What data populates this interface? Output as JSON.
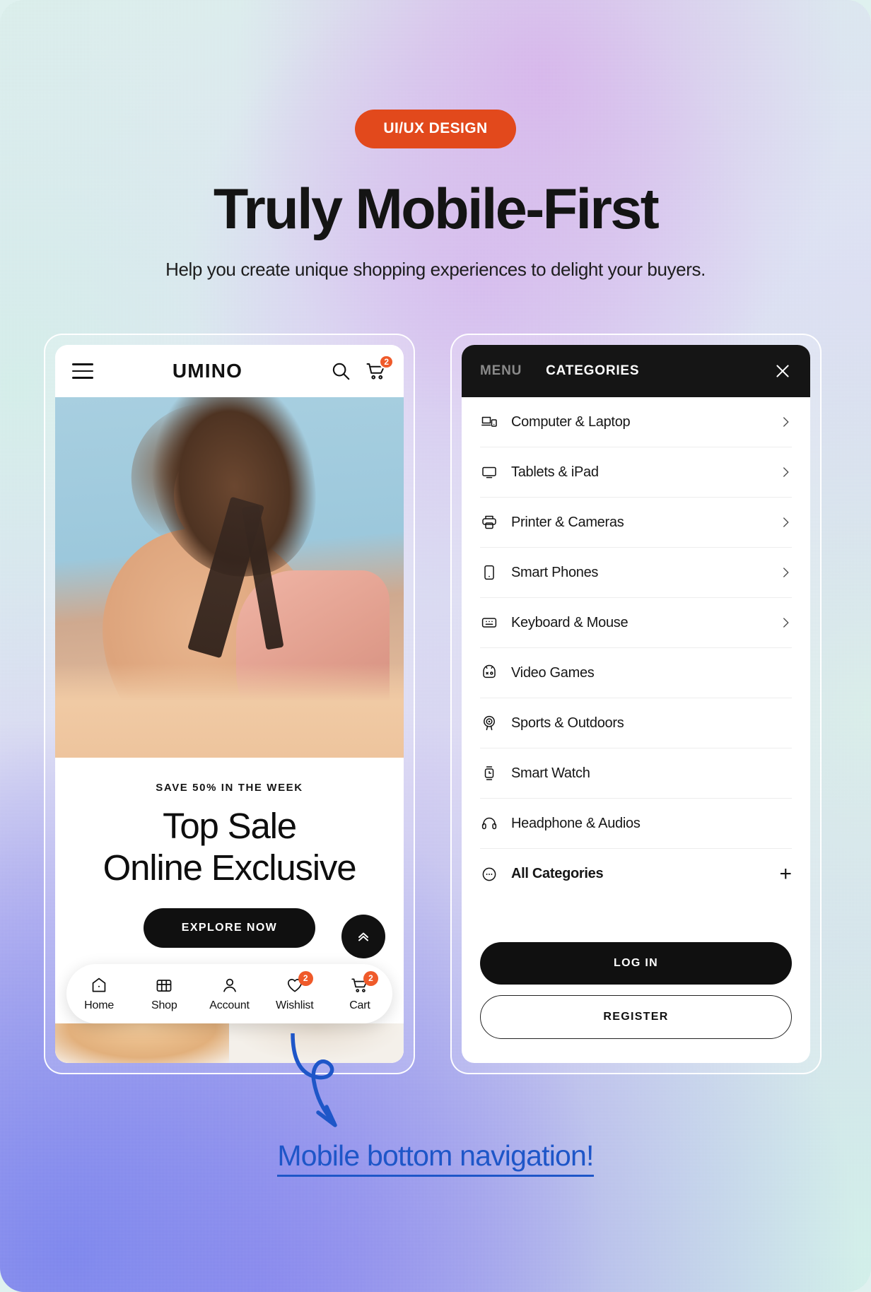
{
  "hero": {
    "badge": "UI/UX DESIGN",
    "title": "Truly Mobile-First",
    "subtitle": "Help you create unique shopping experiences to delight your buyers.",
    "badge_color": "#e2491c"
  },
  "left_phone": {
    "header": {
      "menu_icon": "hamburger-icon",
      "logo": "UMINO",
      "search_icon": "search-icon",
      "cart_icon": "cart-icon",
      "cart_count": "2"
    },
    "promo": {
      "kicker": "SAVE 50% IN THE WEEK",
      "title_line1": "Top Sale",
      "title_line2": "Online Exclusive",
      "cta": "EXPLORE NOW"
    },
    "carousel": {
      "total": 3,
      "active_index": 1
    },
    "fabs": {
      "scroll_top": "chevron-double-up-icon",
      "chat": "chat-bubble-icon",
      "chat_color": "#f05a28"
    },
    "bottom_nav": [
      {
        "label": "Home",
        "icon": "home-icon",
        "badge": ""
      },
      {
        "label": "Shop",
        "icon": "store-icon",
        "badge": ""
      },
      {
        "label": "Account",
        "icon": "user-icon",
        "badge": ""
      },
      {
        "label": "Wishlist",
        "icon": "heart-icon",
        "badge": "2"
      },
      {
        "label": "Cart",
        "icon": "cart-icon",
        "badge": "2"
      }
    ]
  },
  "right_phone": {
    "tabs": {
      "menu": "MENU",
      "categories": "CATEGORIES",
      "active": "CATEGORIES"
    },
    "close_icon": "close-icon",
    "categories": [
      {
        "label": "Computer & Laptop",
        "icon": "computer-laptop-icon",
        "chevron": true
      },
      {
        "label": "Tablets & iPad",
        "icon": "tablet-icon",
        "chevron": true
      },
      {
        "label": "Printer & Cameras",
        "icon": "printer-icon",
        "chevron": true
      },
      {
        "label": "Smart Phones",
        "icon": "smartphone-icon",
        "chevron": true
      },
      {
        "label": "Keyboard & Mouse",
        "icon": "keyboard-icon",
        "chevron": true
      },
      {
        "label": "Video Games",
        "icon": "gamepad-icon",
        "chevron": false
      },
      {
        "label": "Sports & Outdoors",
        "icon": "target-icon",
        "chevron": false
      },
      {
        "label": "Smart Watch",
        "icon": "watch-icon",
        "chevron": false
      },
      {
        "label": "Headphone & Audios",
        "icon": "headphones-icon",
        "chevron": false
      }
    ],
    "all_categories": {
      "label": "All Categories",
      "icon": "ellipsis-circle-icon",
      "plus": "+"
    },
    "auth": {
      "login": "LOG IN",
      "register": "REGISTER"
    }
  },
  "annotation": {
    "caption": "Mobile bottom navigation!",
    "color": "#1e56c8",
    "arrow_icon": "curved-arrow-icon"
  }
}
